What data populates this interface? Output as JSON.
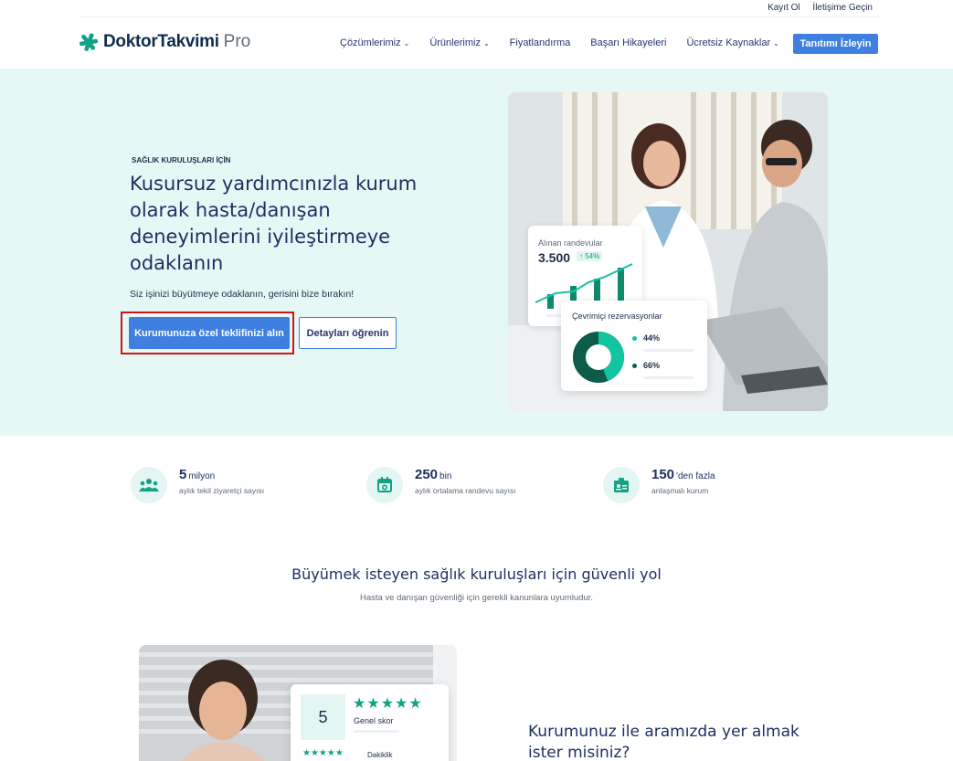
{
  "topbar": {
    "signup": "Kayıt Ol",
    "contact": "İletişime Geçin"
  },
  "brand": {
    "name": "DoktorTakvimi",
    "suffix": "Pro",
    "color": "#12a286"
  },
  "nav": {
    "items": [
      {
        "label": "Çözümlerimiz",
        "dropdown": true
      },
      {
        "label": "Ürünlerimiz",
        "dropdown": true
      },
      {
        "label": "Fiyatlandırma",
        "dropdown": false
      },
      {
        "label": "Başarı Hikayeleri",
        "dropdown": false
      },
      {
        "label": "Ücretsiz Kaynaklar",
        "dropdown": true
      }
    ],
    "cta": "Tanıtımı İzleyin"
  },
  "hero": {
    "eyebrow": "SAĞLIK KURULUŞLARI İÇİN",
    "headline": "Kusursuz yardımcınızla kurum olarak hasta/danışan deneyimlerini iyileştirmeye odaklanın",
    "subline": "Siz işinizi büyütmeye odaklanın, gerisini bize bırakın!",
    "primary_cta": "Kurumunuza özel teklifinizi alın",
    "secondary_cta": "Detayları öğrenin",
    "card_appointments": {
      "title": "Alınan randevular",
      "value": "3.500",
      "badge": "↑ 54%"
    },
    "card_online": {
      "title": "Çevrimiçi rezervasyonlar",
      "legend": [
        {
          "label": "44%",
          "color": "#12c4a0"
        },
        {
          "label": "66%",
          "color": "#0c5c49"
        }
      ]
    }
  },
  "stats": [
    {
      "value": "5",
      "unit": "milyon",
      "desc": "aylık tekil ziyaretçi sayısı",
      "icon": "users-icon"
    },
    {
      "value": "250",
      "unit": "bin",
      "desc": "aylık ortalama randevu sayısı",
      "icon": "calendar-icon"
    },
    {
      "value": "150",
      "unit": "'den fazla",
      "desc": "anlaşmalı kurum",
      "icon": "badge-icon"
    }
  ],
  "section": {
    "title": "Büyümek isteyen sağlık kuruluşları için güvenli yol",
    "subtitle": "Hasta ve danışan güvenliği için gerekli kanunlara uyumludur."
  },
  "score_card": {
    "score": "5",
    "label": "Genel skor",
    "stars": "★★★★★",
    "sub_label": "Dakiklik"
  },
  "join": {
    "title": "Kurumunuz ile aramızda yer almak ister misiniz?"
  }
}
